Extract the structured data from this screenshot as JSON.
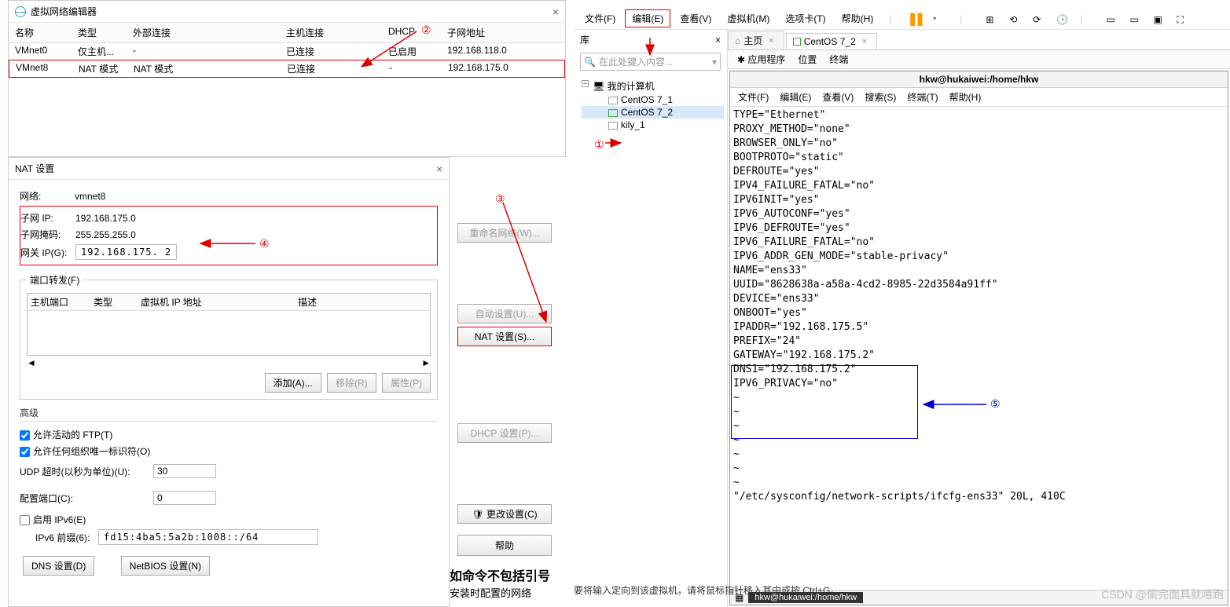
{
  "vne": {
    "title": "虚拟网络编辑器",
    "cols": {
      "name": "名称",
      "type": "类型",
      "ext": "外部连接",
      "host": "主机连接",
      "dhcp": "DHCP",
      "subnet": "子网地址"
    },
    "rows": [
      {
        "name": "VMnet0",
        "type": "仅主机...",
        "ext": "-",
        "host": "已连接",
        "dhcp": "已启用",
        "subnet": "192.168.118.0"
      },
      {
        "name": "VMnet8",
        "type": "NAT 模式",
        "ext": "NAT 模式",
        "host": "已连接",
        "dhcp": "-",
        "subnet": "192.168.175.0"
      }
    ]
  },
  "side": {
    "rename": "重命名网络(W)...",
    "auto": "自动设置(U)...",
    "nat": "NAT 设置(S)...",
    "dhcp": "DHCP 设置(P)...",
    "change": "更改设置(C)",
    "help": "帮助"
  },
  "nat": {
    "title": "NAT 设置",
    "netlabel": "网络:",
    "netval": "vmnet8",
    "subnet_ip_k": "子网 IP:",
    "subnet_ip_v": "192.168.175.0",
    "mask_k": "子网掩码:",
    "mask_v": "255.255.255.0",
    "gw_k": "网关 IP(G):",
    "gw_v": "192.168.175. 2",
    "pf_legend": "端口转发(F)",
    "pf_cols": {
      "hp": "主机端口",
      "type": "类型",
      "vmip": "虚拟机 IP 地址",
      "desc": "描述"
    },
    "add": "添加(A)...",
    "remove": "移除(R)",
    "prop": "属性(P)",
    "adv": "高级",
    "ftp": "允许活动的 FTP(T)",
    "org": "允许任何组织唯一标识符(O)",
    "udp_k": "UDP 超时(以秒为单位)(U):",
    "udp_v": "30",
    "cfgport_k": "配置端口(C):",
    "cfgport_v": "0",
    "ipv6_en": "启用 IPv6(E)",
    "ipv6_pfx_k": "IPv6 前缀(6):",
    "ipv6_pfx_v": "fd15:4ba5:5a2b:1008::/64",
    "dns": "DNS 设置(D)",
    "netbios": "NetBIOS 设置(N)"
  },
  "vm": {
    "menu": {
      "file": "文件(F)",
      "edit": "编辑(E)",
      "view": "查看(V)",
      "vmachine": "虚拟机(M)",
      "tabs": "选项卡(T)",
      "help": "帮助(H)"
    },
    "lib": "库",
    "search_ph": "在此处键入内容...",
    "tree": {
      "root": "我的计算机",
      "n1": "CentOS 7_1",
      "n2": "CentOS 7_2",
      "n3": "kily_1"
    },
    "tabs": {
      "home": "主页",
      "t1": "CentOS 7_2"
    },
    "subbar": {
      "apps": "应用程序",
      "loc": "位置",
      "term": "终端"
    },
    "term_title": "hkw@hukaiwei:/home/hkw",
    "term_menu": {
      "file": "文件(F)",
      "edit": "编辑(E)",
      "view": "查看(V)",
      "search": "搜索(S)",
      "terminal": "终端(T)",
      "help": "帮助(H)"
    },
    "term_text": "TYPE=\"Ethernet\"\nPROXY_METHOD=\"none\"\nBROWSER_ONLY=\"no\"\nBOOTPROTO=\"static\"\nDEFROUTE=\"yes\"\nIPV4_FAILURE_FATAL=\"no\"\nIPV6INIT=\"yes\"\nIPV6_AUTOCONF=\"yes\"\nIPV6_DEFROUTE=\"yes\"\nIPV6_FAILURE_FATAL=\"no\"\nIPV6_ADDR_GEN_MODE=\"stable-privacy\"\nNAME=\"ens33\"\nUUID=\"8628638a-a58a-4cd2-8985-22d3584a91ff\"\nDEVICE=\"ens33\"\nONBOOT=\"yes\"\nIPADDR=\"192.168.175.5\"\nPREFIX=\"24\"\nGATEWAY=\"192.168.175.2\"\nDNS1=\"192.168.175.2\"\nIPV6_PRIVACY=\"no\"\n~\n~\n~\n~\n~\n~\n~\n\"/etc/sysconfig/network-scripts/ifcfg-ens33\" 20L, 410C",
    "status_prompt": "hkw@hukaiwei:/home/hkw"
  },
  "hints": {
    "big": "如命令不包括引号",
    "bottom": "要将输入定向到该虚拟机，请将鼠标指针移入其中或按 Ctrl+G。",
    "install": "安装时配置的网络"
  },
  "watermark": "CSDN @偷完面具就嘻跑",
  "ann": {
    "1": "①",
    "2": "②",
    "3": "③",
    "4": "④",
    "5": "⑤"
  }
}
